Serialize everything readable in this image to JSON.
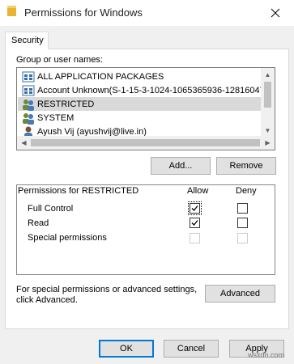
{
  "window": {
    "title": "Permissions for Windows",
    "icon": "folder-icon"
  },
  "tabs": [
    {
      "label": "Security",
      "active": true
    }
  ],
  "users": {
    "header": "Group or user names:",
    "items": [
      {
        "label": "ALL APPLICATION PACKAGES",
        "icon": "app-packages-icon",
        "selected": false
      },
      {
        "label": "Account Unknown(S-1-15-3-1024-1065365936-128160471",
        "icon": "unknown-account-icon",
        "selected": false
      },
      {
        "label": "RESTRICTED",
        "icon": "group-icon",
        "selected": true
      },
      {
        "label": "SYSTEM",
        "icon": "group-icon",
        "selected": false
      },
      {
        "label": "Ayush Vij (ayushvij@live.in)",
        "icon": "user-icon",
        "selected": false
      }
    ]
  },
  "buttons": {
    "add": "Add...",
    "remove": "Remove",
    "advanced": "Advanced",
    "ok": "OK",
    "cancel": "Cancel",
    "apply": "Apply"
  },
  "permissions": {
    "header": "Permissions for RESTRICTED",
    "allow_col": "Allow",
    "deny_col": "Deny",
    "rows": [
      {
        "name": "Full Control",
        "allow": true,
        "deny": false,
        "disabled": false
      },
      {
        "name": "Read",
        "allow": true,
        "deny": false,
        "disabled": false
      },
      {
        "name": "Special permissions",
        "allow": false,
        "deny": false,
        "disabled": true
      }
    ]
  },
  "advanced_note": {
    "line1": "For special permissions or advanced settings,",
    "line2": "click Advanced."
  },
  "watermark": "wsxdn.com",
  "colors": {
    "selection": "#d9d9d9",
    "accent": "#0078d7"
  }
}
